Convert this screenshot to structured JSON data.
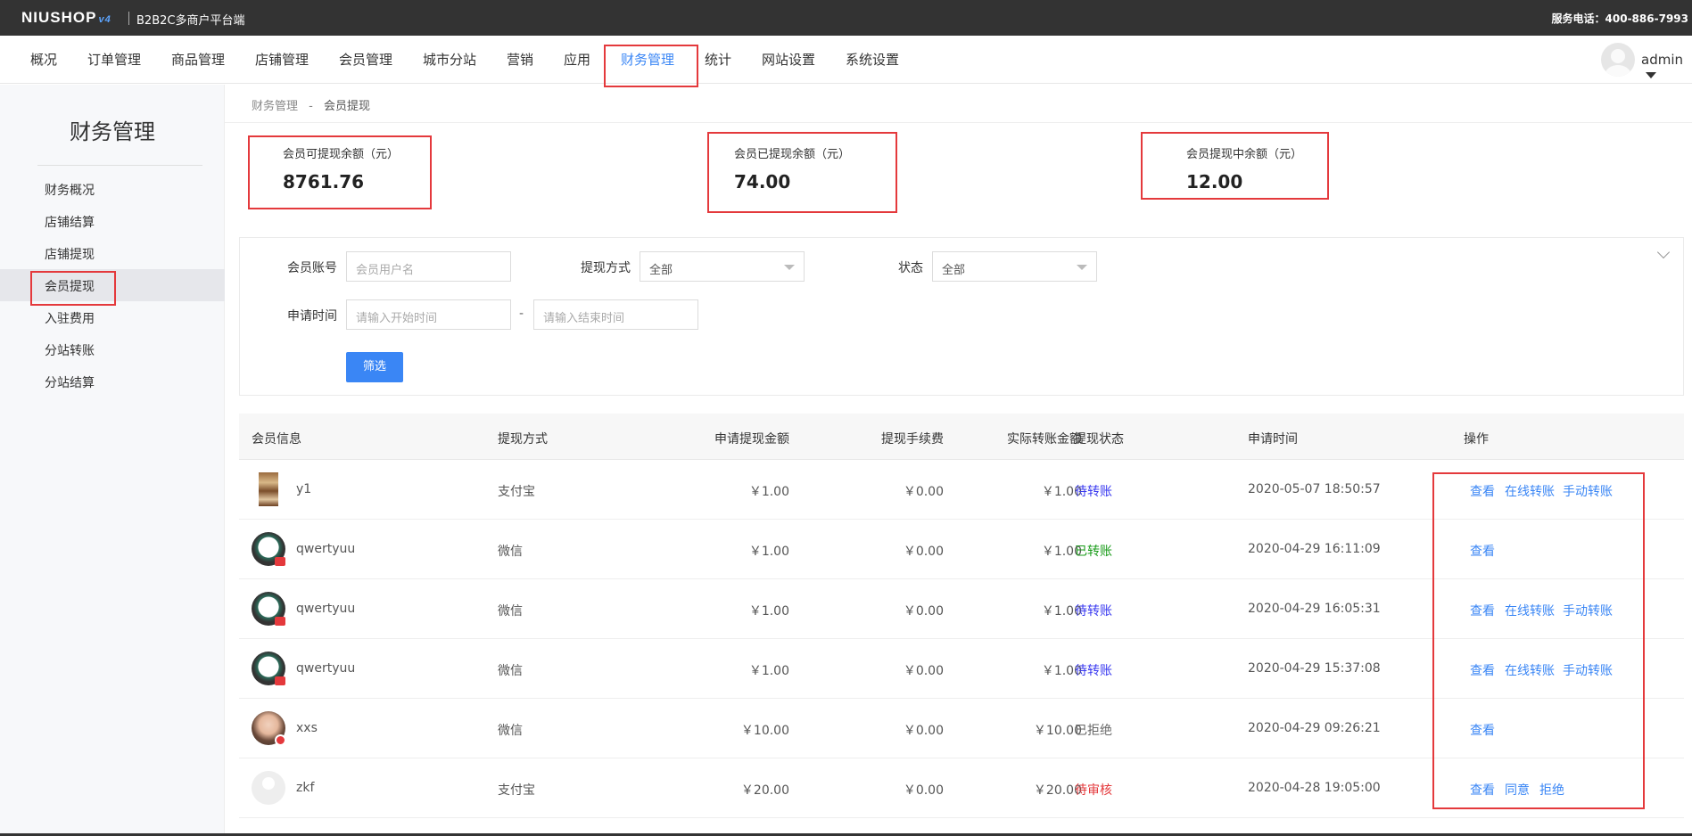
{
  "topbar": {
    "logo": "NIUSHOP",
    "logo_version": "v4",
    "subtitle": "B2B2C多商户平台端",
    "phone": "服务电话：400-886-7993"
  },
  "nav": {
    "items": [
      "概况",
      "订单管理",
      "商品管理",
      "店铺管理",
      "会员管理",
      "城市分站",
      "营销",
      "应用",
      "财务管理",
      "统计",
      "网站设置",
      "系统设置"
    ],
    "active": "财务管理",
    "user": "admin"
  },
  "sidebar": {
    "title": "财务管理",
    "items": [
      "财务概况",
      "店铺结算",
      "店铺提现",
      "会员提现",
      "入驻费用",
      "分站转账",
      "分站结算"
    ],
    "active": "会员提现"
  },
  "breadcrumb": {
    "parent": "财务管理",
    "sep": "-",
    "current": "会员提现"
  },
  "stats": [
    {
      "label": "会员可提现余额（元）",
      "value": "8761.76"
    },
    {
      "label": "会员已提现余额（元）",
      "value": "74.00"
    },
    {
      "label": "会员提现中余额（元）",
      "value": "12.00"
    }
  ],
  "filter": {
    "account_label": "会员账号",
    "account_placeholder": "会员用户名",
    "method_label": "提现方式",
    "method_value": "全部",
    "status_label": "状态",
    "status_value": "全部",
    "time_label": "申请时间",
    "start_placeholder": "请输入开始时间",
    "time_sep": "-",
    "end_placeholder": "请输入结束时间",
    "submit": "筛选"
  },
  "table": {
    "headers": [
      "会员信息",
      "提现方式",
      "申请提现金额",
      "提现手续费",
      "实际转账金额",
      "提现状态",
      "申请时间",
      "操作"
    ],
    "rows": [
      {
        "name": "y1",
        "method": "支付宝",
        "amount": "￥1.00",
        "fee": "￥0.00",
        "actual": "￥1.00",
        "status": "待转账",
        "time": "2020-05-07 18:50:57",
        "actions": [
          "查看",
          "在线转账",
          "手动转账"
        ]
      },
      {
        "name": "qwertyuu",
        "method": "微信",
        "amount": "￥1.00",
        "fee": "￥0.00",
        "actual": "￥1.00",
        "status": "已转账",
        "time": "2020-04-29 16:11:09",
        "actions": [
          "查看"
        ]
      },
      {
        "name": "qwertyuu",
        "method": "微信",
        "amount": "￥1.00",
        "fee": "￥0.00",
        "actual": "￥1.00",
        "status": "待转账",
        "time": "2020-04-29 16:05:31",
        "actions": [
          "查看",
          "在线转账",
          "手动转账"
        ]
      },
      {
        "name": "qwertyuu",
        "method": "微信",
        "amount": "￥1.00",
        "fee": "￥0.00",
        "actual": "￥1.00",
        "status": "待转账",
        "time": "2020-04-29 15:37:08",
        "actions": [
          "查看",
          "在线转账",
          "手动转账"
        ]
      },
      {
        "name": "xxs",
        "method": "微信",
        "amount": "￥10.00",
        "fee": "￥0.00",
        "actual": "￥10.00",
        "status": "已拒绝",
        "time": "2020-04-29 09:26:21",
        "actions": [
          "查看"
        ]
      },
      {
        "name": "zkf",
        "method": "支付宝",
        "amount": "￥20.00",
        "fee": "￥0.00",
        "actual": "￥20.00",
        "status": "待审核",
        "time": "2020-04-28 19:05:00",
        "actions": [
          "查看",
          "同意",
          "拒绝"
        ]
      }
    ]
  },
  "colors": {
    "accent": "#3a86f5",
    "topbar": "#333333",
    "highlight": "#e4393c",
    "status_pending": "#3a3af0",
    "status_done": "#1a9c1a",
    "status_review": "#e4393c"
  }
}
